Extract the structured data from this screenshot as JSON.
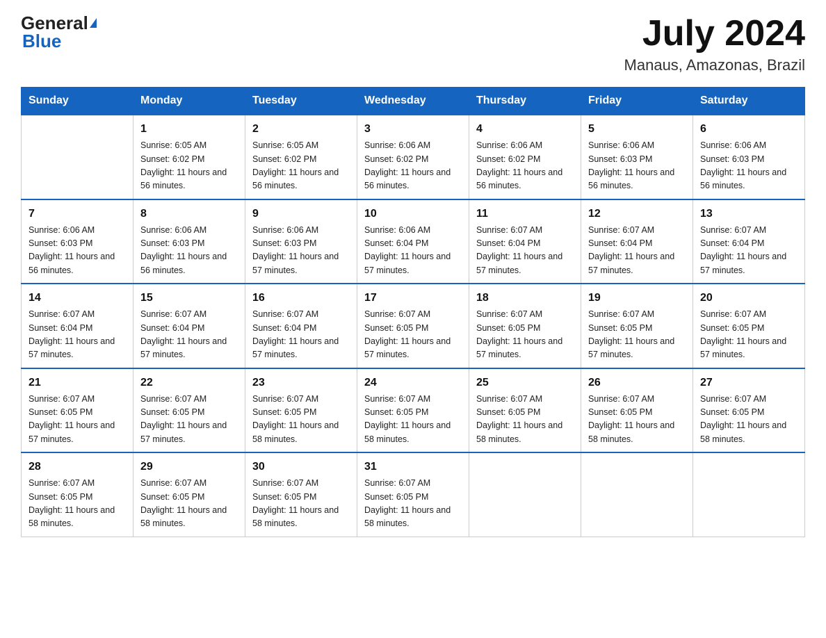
{
  "header": {
    "logo_general": "General",
    "logo_blue": "Blue",
    "title": "July 2024",
    "subtitle": "Manaus, Amazonas, Brazil"
  },
  "days_of_week": [
    "Sunday",
    "Monday",
    "Tuesday",
    "Wednesday",
    "Thursday",
    "Friday",
    "Saturday"
  ],
  "weeks": [
    [
      {
        "day": "",
        "sunrise": "",
        "sunset": "",
        "daylight": ""
      },
      {
        "day": "1",
        "sunrise": "Sunrise: 6:05 AM",
        "sunset": "Sunset: 6:02 PM",
        "daylight": "Daylight: 11 hours and 56 minutes."
      },
      {
        "day": "2",
        "sunrise": "Sunrise: 6:05 AM",
        "sunset": "Sunset: 6:02 PM",
        "daylight": "Daylight: 11 hours and 56 minutes."
      },
      {
        "day": "3",
        "sunrise": "Sunrise: 6:06 AM",
        "sunset": "Sunset: 6:02 PM",
        "daylight": "Daylight: 11 hours and 56 minutes."
      },
      {
        "day": "4",
        "sunrise": "Sunrise: 6:06 AM",
        "sunset": "Sunset: 6:02 PM",
        "daylight": "Daylight: 11 hours and 56 minutes."
      },
      {
        "day": "5",
        "sunrise": "Sunrise: 6:06 AM",
        "sunset": "Sunset: 6:03 PM",
        "daylight": "Daylight: 11 hours and 56 minutes."
      },
      {
        "day": "6",
        "sunrise": "Sunrise: 6:06 AM",
        "sunset": "Sunset: 6:03 PM",
        "daylight": "Daylight: 11 hours and 56 minutes."
      }
    ],
    [
      {
        "day": "7",
        "sunrise": "Sunrise: 6:06 AM",
        "sunset": "Sunset: 6:03 PM",
        "daylight": "Daylight: 11 hours and 56 minutes."
      },
      {
        "day": "8",
        "sunrise": "Sunrise: 6:06 AM",
        "sunset": "Sunset: 6:03 PM",
        "daylight": "Daylight: 11 hours and 56 minutes."
      },
      {
        "day": "9",
        "sunrise": "Sunrise: 6:06 AM",
        "sunset": "Sunset: 6:03 PM",
        "daylight": "Daylight: 11 hours and 57 minutes."
      },
      {
        "day": "10",
        "sunrise": "Sunrise: 6:06 AM",
        "sunset": "Sunset: 6:04 PM",
        "daylight": "Daylight: 11 hours and 57 minutes."
      },
      {
        "day": "11",
        "sunrise": "Sunrise: 6:07 AM",
        "sunset": "Sunset: 6:04 PM",
        "daylight": "Daylight: 11 hours and 57 minutes."
      },
      {
        "day": "12",
        "sunrise": "Sunrise: 6:07 AM",
        "sunset": "Sunset: 6:04 PM",
        "daylight": "Daylight: 11 hours and 57 minutes."
      },
      {
        "day": "13",
        "sunrise": "Sunrise: 6:07 AM",
        "sunset": "Sunset: 6:04 PM",
        "daylight": "Daylight: 11 hours and 57 minutes."
      }
    ],
    [
      {
        "day": "14",
        "sunrise": "Sunrise: 6:07 AM",
        "sunset": "Sunset: 6:04 PM",
        "daylight": "Daylight: 11 hours and 57 minutes."
      },
      {
        "day": "15",
        "sunrise": "Sunrise: 6:07 AM",
        "sunset": "Sunset: 6:04 PM",
        "daylight": "Daylight: 11 hours and 57 minutes."
      },
      {
        "day": "16",
        "sunrise": "Sunrise: 6:07 AM",
        "sunset": "Sunset: 6:04 PM",
        "daylight": "Daylight: 11 hours and 57 minutes."
      },
      {
        "day": "17",
        "sunrise": "Sunrise: 6:07 AM",
        "sunset": "Sunset: 6:05 PM",
        "daylight": "Daylight: 11 hours and 57 minutes."
      },
      {
        "day": "18",
        "sunrise": "Sunrise: 6:07 AM",
        "sunset": "Sunset: 6:05 PM",
        "daylight": "Daylight: 11 hours and 57 minutes."
      },
      {
        "day": "19",
        "sunrise": "Sunrise: 6:07 AM",
        "sunset": "Sunset: 6:05 PM",
        "daylight": "Daylight: 11 hours and 57 minutes."
      },
      {
        "day": "20",
        "sunrise": "Sunrise: 6:07 AM",
        "sunset": "Sunset: 6:05 PM",
        "daylight": "Daylight: 11 hours and 57 minutes."
      }
    ],
    [
      {
        "day": "21",
        "sunrise": "Sunrise: 6:07 AM",
        "sunset": "Sunset: 6:05 PM",
        "daylight": "Daylight: 11 hours and 57 minutes."
      },
      {
        "day": "22",
        "sunrise": "Sunrise: 6:07 AM",
        "sunset": "Sunset: 6:05 PM",
        "daylight": "Daylight: 11 hours and 57 minutes."
      },
      {
        "day": "23",
        "sunrise": "Sunrise: 6:07 AM",
        "sunset": "Sunset: 6:05 PM",
        "daylight": "Daylight: 11 hours and 58 minutes."
      },
      {
        "day": "24",
        "sunrise": "Sunrise: 6:07 AM",
        "sunset": "Sunset: 6:05 PM",
        "daylight": "Daylight: 11 hours and 58 minutes."
      },
      {
        "day": "25",
        "sunrise": "Sunrise: 6:07 AM",
        "sunset": "Sunset: 6:05 PM",
        "daylight": "Daylight: 11 hours and 58 minutes."
      },
      {
        "day": "26",
        "sunrise": "Sunrise: 6:07 AM",
        "sunset": "Sunset: 6:05 PM",
        "daylight": "Daylight: 11 hours and 58 minutes."
      },
      {
        "day": "27",
        "sunrise": "Sunrise: 6:07 AM",
        "sunset": "Sunset: 6:05 PM",
        "daylight": "Daylight: 11 hours and 58 minutes."
      }
    ],
    [
      {
        "day": "28",
        "sunrise": "Sunrise: 6:07 AM",
        "sunset": "Sunset: 6:05 PM",
        "daylight": "Daylight: 11 hours and 58 minutes."
      },
      {
        "day": "29",
        "sunrise": "Sunrise: 6:07 AM",
        "sunset": "Sunset: 6:05 PM",
        "daylight": "Daylight: 11 hours and 58 minutes."
      },
      {
        "day": "30",
        "sunrise": "Sunrise: 6:07 AM",
        "sunset": "Sunset: 6:05 PM",
        "daylight": "Daylight: 11 hours and 58 minutes."
      },
      {
        "day": "31",
        "sunrise": "Sunrise: 6:07 AM",
        "sunset": "Sunset: 6:05 PM",
        "daylight": "Daylight: 11 hours and 58 minutes."
      },
      {
        "day": "",
        "sunrise": "",
        "sunset": "",
        "daylight": ""
      },
      {
        "day": "",
        "sunrise": "",
        "sunset": "",
        "daylight": ""
      },
      {
        "day": "",
        "sunrise": "",
        "sunset": "",
        "daylight": ""
      }
    ]
  ]
}
